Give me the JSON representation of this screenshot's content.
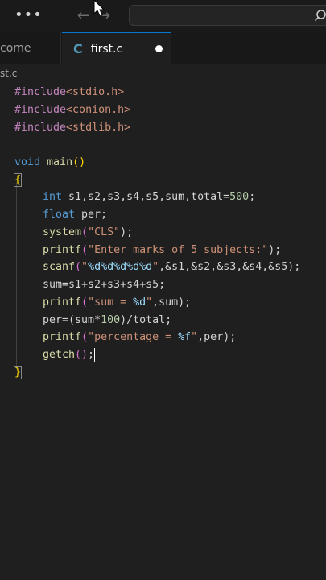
{
  "titlebar": {
    "menu_icon": "more-horizontal-icon",
    "back_icon": "arrow-left-icon",
    "forward_icon": "arrow-right-icon",
    "search_icon": "search-icon"
  },
  "tabs": [
    {
      "label": "come",
      "active": false
    },
    {
      "label": "first.c",
      "active": true,
      "icon": "C",
      "dirty": true
    }
  ],
  "breadcrumb": "st.c",
  "code": {
    "l1": {
      "kw": "#include",
      "arg": "<stdio.h>"
    },
    "l2": {
      "kw": "#include",
      "arg": "<conion.h>"
    },
    "l3": {
      "kw": "#include",
      "arg": "<stdlib.h>"
    },
    "l5": {
      "type": "void",
      "name": "main",
      "parens": "()"
    },
    "open_brace": "{",
    "l7": {
      "type": "int",
      "rest": " s1,s2,s3,s4,s5,sum,total=",
      "num": "500",
      "end": ";"
    },
    "l8": {
      "type": "float",
      "rest": " per;"
    },
    "l9": {
      "fn": "system",
      "open": "(",
      "str": "\"CLS\"",
      "close": ");"
    },
    "l10": {
      "fn": "printf",
      "open": "(",
      "str": "\"Enter marks of 5 subjects:\"",
      "close": ");"
    },
    "l11": {
      "fn": "scanf",
      "open": "(",
      "q1": "\"",
      "fmt": "%d%d%d%d%d",
      "q2": "\"",
      "rest": ",&s1,&s2,&s3,&s4,&s5);"
    },
    "l12": {
      "text": "sum=s1+s2+s3+s4+s5;"
    },
    "l13": {
      "fn": "printf",
      "open": "(",
      "str1": "\"sum = ",
      "fmt": "%d",
      "str2": "\"",
      "rest": ",sum);"
    },
    "l14": {
      "pre": "per=(sum*",
      "num": "100",
      "post": ")/total;"
    },
    "l15": {
      "fn": "printf",
      "open": "(",
      "str1": "\"percentage = ",
      "fmt": "%f",
      "str2": "\"",
      "rest": ",per);"
    },
    "l16": {
      "fn": "getch",
      "parens": "()",
      "end": ";"
    },
    "close_brace": "}"
  }
}
